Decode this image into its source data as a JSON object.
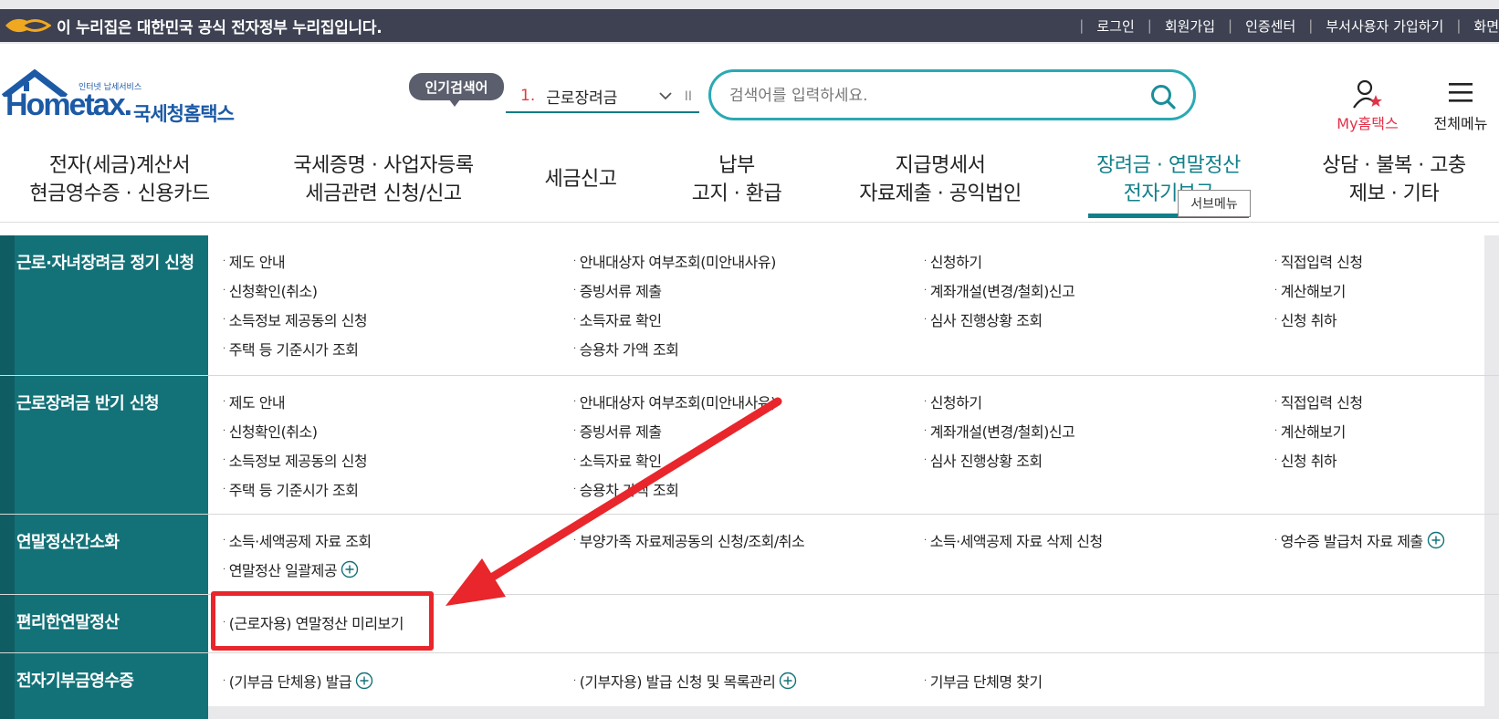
{
  "gov": {
    "notice": "이 누리집은 대한민국 공식 전자정부 누리집입니다.",
    "links": [
      "로그인",
      "회원가입",
      "인증센터",
      "부서사용자 가입하기",
      "화면"
    ]
  },
  "logo": {
    "eng": "Hometax.",
    "kor": "국세청홈택스",
    "sub": "인터넷 납세서비스"
  },
  "popular": {
    "badge": "인기검색어",
    "rank": "1.",
    "keyword": "근로장려금",
    "pause": "II"
  },
  "search": {
    "placeholder": "검색어를 입력하세요."
  },
  "utility": {
    "my": "My홈택스",
    "all": "전체메뉴"
  },
  "gnb": [
    {
      "line1": "전자(세금)계산서",
      "line2": "현금영수증 · 신용카드"
    },
    {
      "line1": "국세증명 · 사업자등록",
      "line2": "세금관련 신청/신고"
    },
    {
      "line1": "세금신고",
      "line2": ""
    },
    {
      "line1": "납부",
      "line2": "고지 · 환급"
    },
    {
      "line1": "지급명세서",
      "line2": "자료제출 · 공익법인"
    },
    {
      "line1": "장려금 · 연말정산",
      "line2": "전자기부금"
    },
    {
      "line1": "상담 · 불복 · 고충",
      "line2": "제보 · 기타"
    }
  ],
  "submenu_tip": "서브메뉴",
  "sections": [
    {
      "title": "근로·자녀장려금 정기 신청",
      "links": [
        "제도 안내",
        "안내대상자 여부조회(미안내사유)",
        "신청하기",
        "직접입력 신청",
        "신청확인(취소)",
        "증빙서류 제출",
        "계좌개설(변경/철회)신고",
        "계산해보기",
        "소득정보 제공동의 신청",
        "소득자료 확인",
        "심사 진행상황 조회",
        "신청 취하",
        "주택 등 기준시가 조회",
        "승용차 가액 조회"
      ]
    },
    {
      "title": "근로장려금 반기 신청",
      "links": [
        "제도 안내",
        "안내대상자 여부조회(미안내사유)",
        "신청하기",
        "직접입력 신청",
        "신청확인(취소)",
        "증빙서류 제출",
        "계좌개설(변경/철회)신고",
        "계산해보기",
        "소득정보 제공동의 신청",
        "소득자료 확인",
        "심사 진행상황 조회",
        "신청 취하",
        "주택 등 기준시가 조회",
        "승용차 가액 조회"
      ]
    },
    {
      "title": "연말정산간소화",
      "links": [
        "소득·세액공제 자료 조회",
        "부양가족 자료제공동의 신청/조회/취소",
        "소득·세액공제 자료 삭제 신청",
        "영수증 발급처 자료 제출",
        "연말정산 일괄제공"
      ]
    },
    {
      "title": "편리한연말정산",
      "links": [
        "(근로자용) 연말정산 미리보기"
      ]
    },
    {
      "title": "전자기부금영수증",
      "links": [
        "(기부금 단체용) 발급",
        "(기부자용) 발급 신청 및 목록관리",
        "기부금 단체명 찾기"
      ]
    }
  ],
  "colors": {
    "teal": "#137278",
    "search_border": "#2aa9b3",
    "highlight": "#e8262b",
    "my_label": "#e2324a"
  }
}
